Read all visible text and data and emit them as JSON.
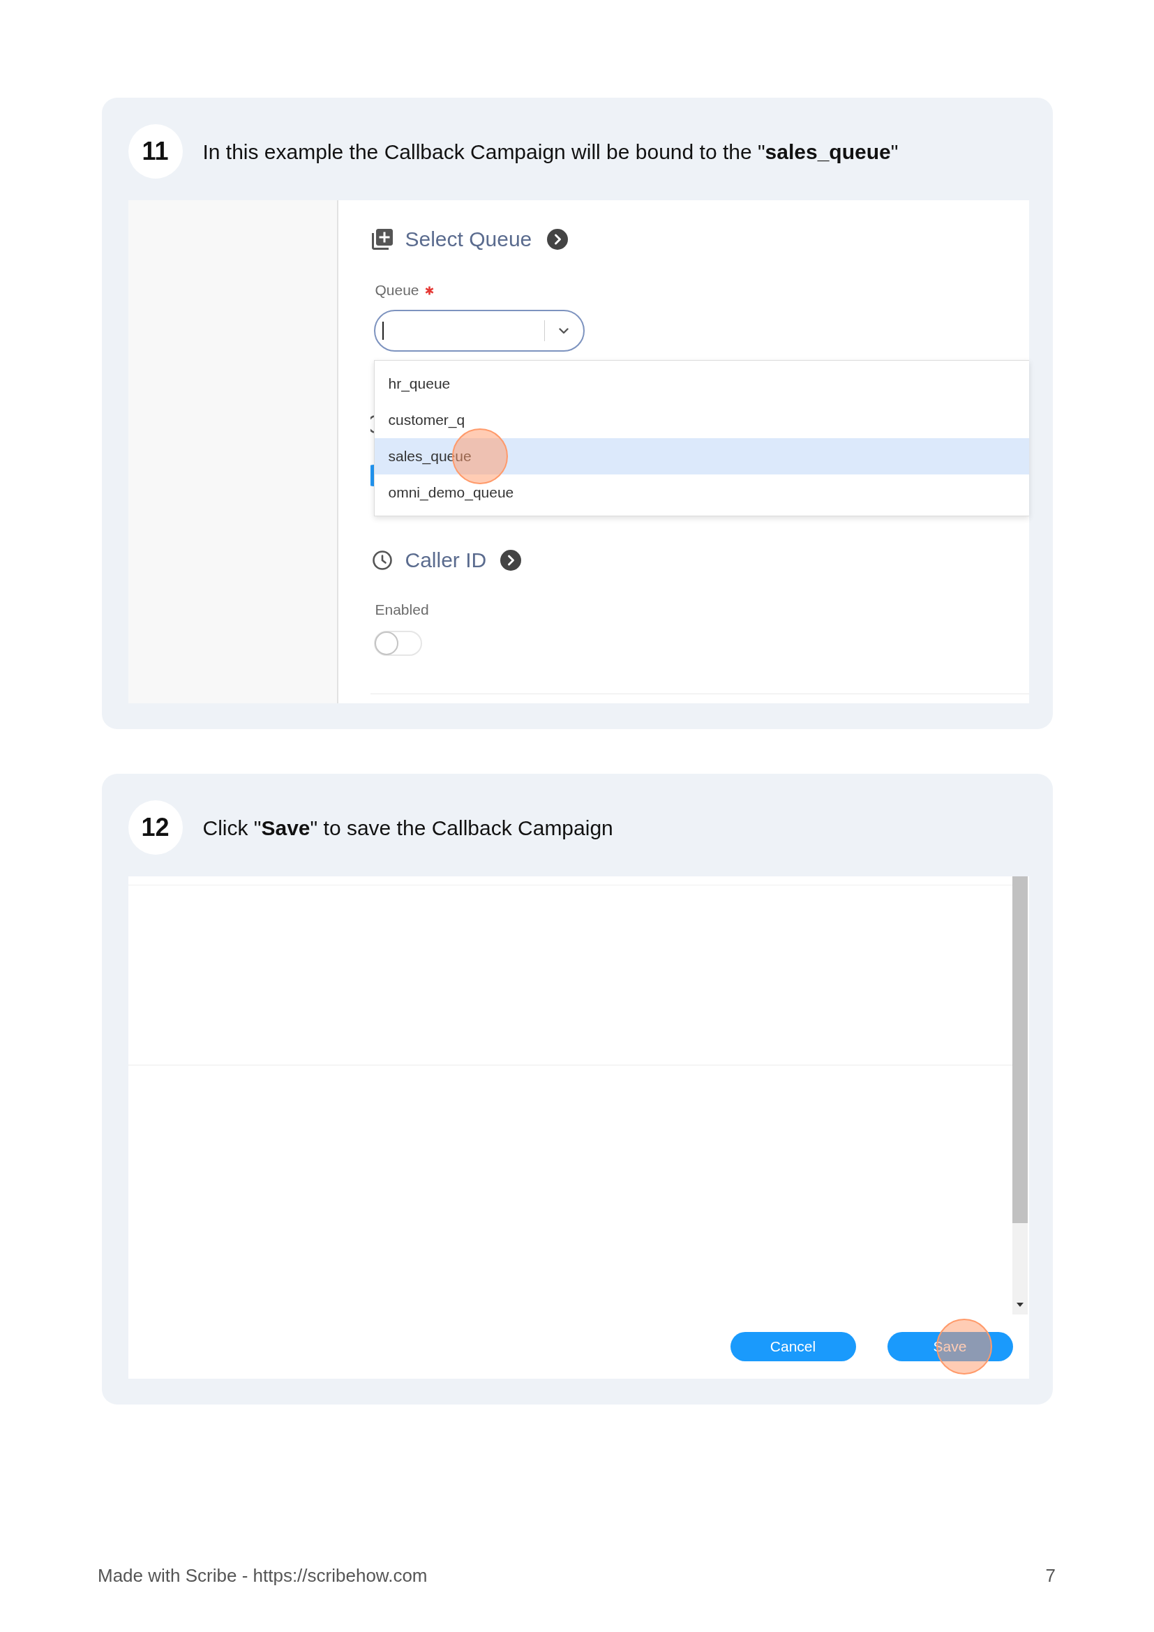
{
  "steps": [
    {
      "number": "11",
      "instruction": "In this example the Callback Campaign will be bound to the \"**sales_queue**\"",
      "screen": {
        "kind": "queue_form",
        "queue": {
          "title": "Select Queue",
          "field": {
            "label": "Queue",
            "required": true,
            "focused": true
          },
          "options": [
            {
              "label": "hr_queue",
              "selected": false,
              "clicked": false
            },
            {
              "label": "customer_q",
              "selected": false,
              "clicked": false
            },
            {
              "label": "sales_queue",
              "selected": true,
              "clicked": true
            },
            {
              "label": "omni_demo_queue",
              "selected": false,
              "clicked": false
            }
          ]
        },
        "caller_id": {
          "title": "Caller ID",
          "toggle": {
            "label": "Enabled",
            "on": false
          }
        }
      }
    },
    {
      "number": "12",
      "instruction": "Click \"**Save**\" to save the Callback Campaign",
      "screen": {
        "kind": "save_dialog",
        "buttons": [
          {
            "label": "Cancel",
            "clicked": false
          },
          {
            "label": "Save",
            "clicked": true
          }
        ]
      }
    }
  ],
  "footer": {
    "text": "Made with Scribe - https://scribehow.com",
    "page_number": "7"
  }
}
